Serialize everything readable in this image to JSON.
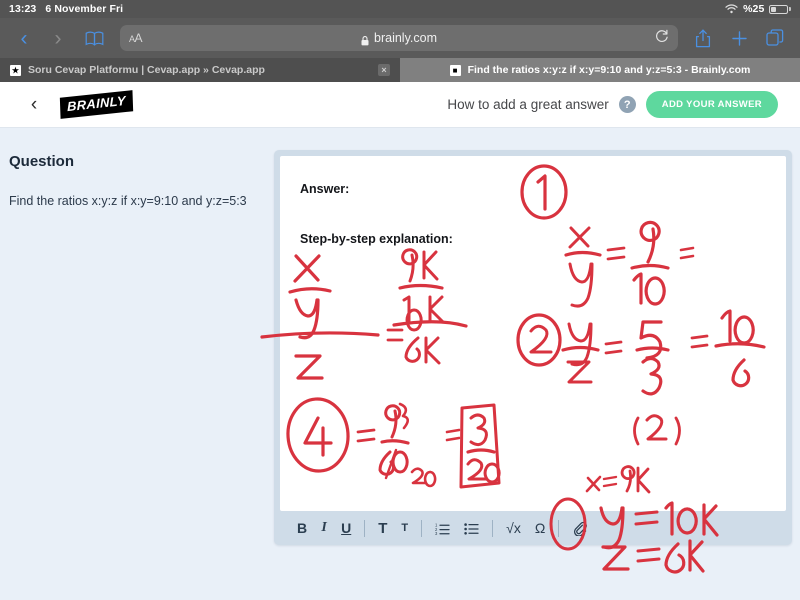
{
  "status_bar": {
    "time": "13:23",
    "date": "6 November Fri",
    "wifi_icon": "wifi-icon",
    "battery_percent": "%25"
  },
  "browser": {
    "back_icon": "chevron-left-icon",
    "forward_icon": "chevron-right-icon",
    "bookmarks_icon": "book-icon",
    "text_size_label": "AA",
    "lock_icon": "lock-icon",
    "url": "brainly.com",
    "reload_icon": "reload-icon",
    "share_icon": "share-icon",
    "new_tab_icon": "plus-icon",
    "tabs_icon": "tabs-icon",
    "tabs": [
      {
        "title": "Soru Cevap Platformu | Cevap.app » Cevap.app",
        "favicon": "brainly-favicon",
        "close_label": "×",
        "active": false
      },
      {
        "title": "Find the ratios x:y:z if x:y=9:10 and y:z=5:3 - Brainly.com",
        "favicon": "page-favicon",
        "active": true
      }
    ]
  },
  "site_header": {
    "back_icon": "chevron-left-icon",
    "logo_text": "BRAINLY",
    "help_text": "How to add a great answer",
    "help_icon": "question-mark-icon",
    "add_answer_label": "ADD YOUR ANSWER",
    "accent_green": "#5ED89E"
  },
  "question_panel": {
    "heading": "Question",
    "body": "Find the ratios x:y:z if x:y=9:10 and y:z=5:3"
  },
  "editor": {
    "answer_label": "Answer:",
    "explanation_label": "Step-by-step explanation:",
    "toolbar": [
      {
        "name": "bold-button",
        "label": "B"
      },
      {
        "name": "italic-button",
        "label": "I"
      },
      {
        "name": "underline-button",
        "label": "U"
      },
      {
        "name": "heading-large-button",
        "label": "T"
      },
      {
        "name": "heading-small-button",
        "label": "T"
      },
      {
        "name": "numbered-list-button",
        "label": "numbered-list-icon"
      },
      {
        "name": "bullet-list-button",
        "label": "bullet-list-icon"
      },
      {
        "name": "math-formula-button",
        "label": "√x"
      },
      {
        "name": "symbol-button",
        "label": "Ω"
      },
      {
        "name": "attachment-button",
        "label": "attachment-icon"
      }
    ]
  },
  "annotations": {
    "ink_color": "#d8333f",
    "left_work": {
      "numerator_x": "x",
      "numerator_y": "y",
      "denominator_z": "z",
      "right_top_num": "9K",
      "right_top_den": "10K",
      "right_bottom": "6K",
      "circled_result": "4",
      "frac_num": "9",
      "frac_num_struck": "3",
      "frac_den": "60",
      "frac_den_struck": "20",
      "boxed_num": "3",
      "boxed_den": "20"
    },
    "right_work": {
      "step1_marker": "1",
      "step1_lhs_num": "x",
      "step1_lhs_den": "y",
      "step1_rhs_num": "9",
      "step1_rhs_den": "10",
      "step1_trailing_eq": "=",
      "step2_marker": "2",
      "step2_lhs_num": "y",
      "step2_lhs_den": "z",
      "step2_rhs_num": "5",
      "step2_rhs_den": "3",
      "step2_alt_num": "10",
      "step2_alt_den": "6",
      "step2_factor": "(2)"
    },
    "final": {
      "x": "x = 9k",
      "y": "y = 10k",
      "z": "z = 6k"
    }
  }
}
